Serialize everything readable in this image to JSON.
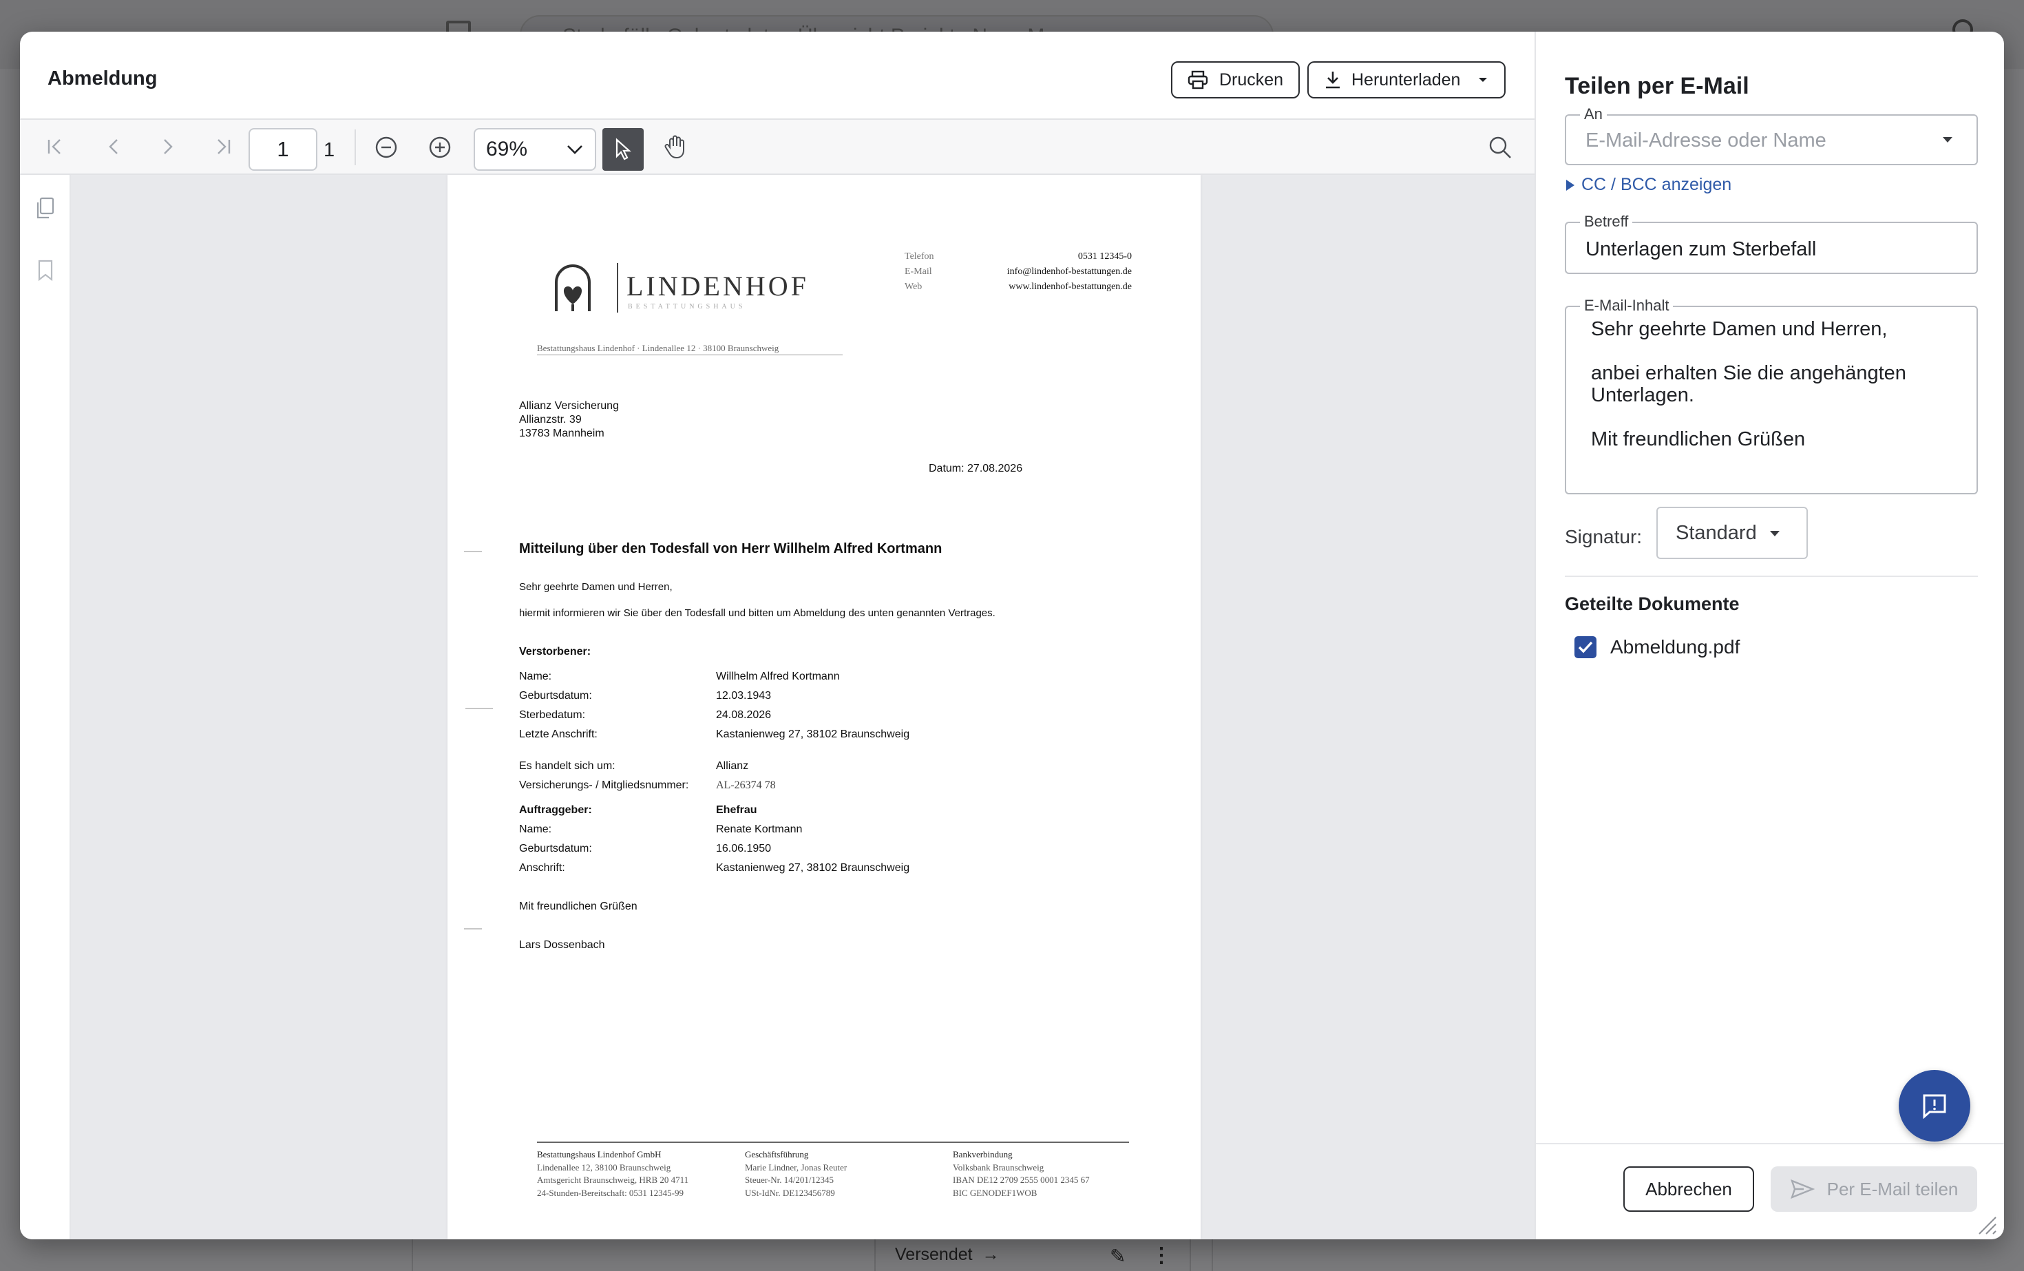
{
  "background": {
    "search_text": "Sterbefälle    Geburtsdaten    Übersicht    Projekte    Neue M",
    "card_status": "Versendet"
  },
  "viewer": {
    "title": "Abmeldung",
    "print_label": "Drucken",
    "download_label": "Herunterladen",
    "page_current": "1",
    "page_total": "1",
    "zoom": "69%"
  },
  "letter": {
    "company_name": "LINDENHOF",
    "company_sub": "BESTATTUNGSHAUS",
    "contact": [
      {
        "k": "Telefon",
        "v": "0531 12345-0"
      },
      {
        "k": "E-Mail",
        "v": "info@lindenhof-bestattungen.de"
      },
      {
        "k": "Web",
        "v": "www.lindenhof-bestattungen.de"
      }
    ],
    "sender_line": "Bestattungshaus Lindenhof · Lindenallee 12 · 38100 Braunschweig",
    "recipient": [
      "Allianz Versicherung",
      "Allianzstr. 39",
      "13783 Mannheim"
    ],
    "date": "Datum: 27.08.2026",
    "subject": "Mitteilung über den Todesfall von Herr  Willhelm Alfred Kortmann",
    "salutation": "Sehr geehrte Damen und Herren,",
    "intro": "hiermit informieren wir Sie über den Todesfall und bitten um Abmeldung des unten genannten Vertrages.",
    "deceased_heading": "Verstorbener:",
    "deceased": [
      {
        "k": "Name:",
        "v": "Willhelm Alfred Kortmann"
      },
      {
        "k": "Geburtsdatum:",
        "v": "12.03.1943"
      },
      {
        "k": "Sterbedatum:",
        "v": "24.08.2026"
      },
      {
        "k": "Letzte Anschrift:",
        "v": "Kastanienweg 27, 38102 Braunschweig"
      }
    ],
    "contract": [
      {
        "k": "Es handelt sich um:",
        "v": "Allianz"
      },
      {
        "k": "Versicherungs- / Mitgliedsnummer:",
        "v": "AL-26374 78"
      }
    ],
    "client_heading": "Auftraggeber:",
    "client_relation": "Ehefrau",
    "client": [
      {
        "k": "Name:",
        "v": "Renate Kortmann"
      },
      {
        "k": "Geburtsdatum:",
        "v": "16.06.1950"
      },
      {
        "k": "Anschrift:",
        "v": "Kastanienweg 27, 38102 Braunschweig"
      }
    ],
    "closing": "Mit freundlichen Grüßen",
    "signer": "Lars Dossenbach",
    "footer": [
      [
        "Bestattungshaus Lindenhof GmbH",
        "Lindenallee 12, 38100 Braunschweig",
        "Amtsgericht Braunschweig, HRB 20 4711",
        "24-Stunden-Bereitschaft: 0531 12345-99"
      ],
      [
        "Geschäftsführung",
        "Marie Lindner, Jonas Reuter",
        "Steuer-Nr. 14/201/12345",
        "USt-IdNr. DE123456789"
      ],
      [
        "Bankverbindung",
        "Volksbank Braunschweig",
        "IBAN DE12 2709 2555 0001 2345 67",
        "BIC GENODEF1WOB"
      ]
    ]
  },
  "share": {
    "title": "Teilen per E-Mail",
    "to_label": "An",
    "to_placeholder": "E-Mail-Adresse oder Name",
    "cc_link": "CC / BCC anzeigen",
    "subject_label": "Betreff",
    "subject_value": "Unterlagen zum Sterbefall",
    "body_label": "E-Mail-Inhalt",
    "body_lines": [
      "Sehr geehrte Damen und Herren,",
      "",
      "anbei erhalten Sie die angehängten",
      "Unterlagen.",
      "",
      "Mit freundlichen Grüßen"
    ],
    "signature_label": "Signatur:",
    "signature_value": "Standard",
    "docs_title": "Geteilte Dokumente",
    "doc_name": "Abmeldung.pdf",
    "doc_checked": true,
    "cancel_label": "Abbrechen",
    "send_label": "Per E-Mail teilen"
  },
  "colors": {
    "accent": "#2c4e9e",
    "link": "#2f5aa8",
    "overlay": "#7b7b7d"
  }
}
